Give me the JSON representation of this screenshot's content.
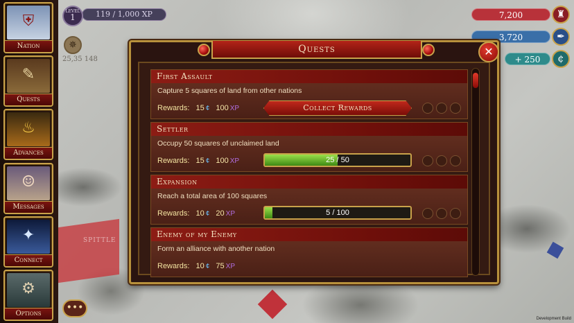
{
  "sidebar": {
    "items": [
      {
        "label": "Nation",
        "icon": "nation-icon"
      },
      {
        "label": "Quests",
        "icon": "quests-icon"
      },
      {
        "label": "Advances",
        "icon": "advances-icon"
      },
      {
        "label": "Messages",
        "icon": "messages-icon"
      },
      {
        "label": "Connect",
        "icon": "connect-icon"
      },
      {
        "label": "Options",
        "icon": "options-icon"
      }
    ]
  },
  "player": {
    "level_label": "LEVEL",
    "level": "1",
    "xp": "119 / 1,000 XP",
    "coords": "25,35 148"
  },
  "resources": [
    {
      "value": "7,200",
      "color": "#b8323a"
    },
    {
      "value": "3,720",
      "color": "#3a6fa8"
    },
    {
      "value": "+ 250",
      "color": "#2e8b8b"
    }
  ],
  "modal": {
    "title": "Quests",
    "close": "✕"
  },
  "quests": [
    {
      "title": "First Assault",
      "description": "Capture 5 squares of land from other nations",
      "rewards_label": "Rewards:",
      "coins": "15",
      "xp": "100",
      "xp_unit": "XP",
      "action": "Collect Rewards",
      "progress": null
    },
    {
      "title": "Settler",
      "description": "Occupy 50 squares of unclaimed land",
      "rewards_label": "Rewards:",
      "coins": "15",
      "xp": "100",
      "xp_unit": "XP",
      "progress": {
        "text": "25 / 50",
        "fraction": 0.5
      }
    },
    {
      "title": "Expansion",
      "description": "Reach a total area of 100 squares",
      "rewards_label": "Rewards:",
      "coins": "10",
      "xp": "20",
      "xp_unit": "XP",
      "progress": {
        "text": "5 / 100",
        "fraction": 0.05
      }
    },
    {
      "title": "Enemy of my Enemy",
      "description": "Form an alliance with another nation",
      "rewards_label": "Rewards:",
      "coins": "10",
      "xp": "75",
      "xp_unit": "XP",
      "progress": null
    }
  ],
  "map": {
    "territory_label": "SPITTLE",
    "dev_build": "Development Build"
  }
}
